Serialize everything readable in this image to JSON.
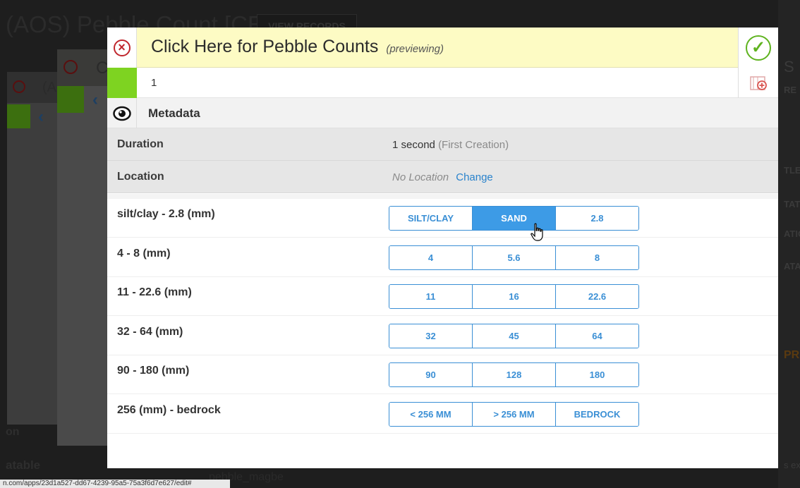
{
  "background": {
    "app_title": "(AOS) Pebble Count [CERT]",
    "view_records_label": "VIEW RECORDS",
    "stack1_title": "(AC",
    "stack2_title": "C",
    "right_col": [
      "S",
      "RE",
      "TLE (S",
      "TATU",
      "ATION",
      "ATA F",
      "PR",
      "s ex"
    ],
    "bottom_left_1": "on",
    "bottom_left_2": "atable",
    "file_name": "pebble_magbe",
    "url": "n.com/apps/23d1a527-dd67-4239-95a5-75a3f6d7e627/edit#"
  },
  "modal": {
    "title": "Click Here for Pebble Counts",
    "title_sub": "(previewing)",
    "row1_value": "1",
    "metadata_label": "Metadata",
    "duration": {
      "label": "Duration",
      "value": "1 second",
      "note": "(First Creation)"
    },
    "location": {
      "label": "Location",
      "value": "No Location",
      "action": "Change"
    }
  },
  "questions": [
    {
      "label": "silt/clay - 2.8 (mm)",
      "options": [
        "SILT/CLAY",
        "SAND",
        "2.8"
      ],
      "selected": 1
    },
    {
      "label": "4 - 8 (mm)",
      "options": [
        "4",
        "5.6",
        "8"
      ],
      "selected": -1
    },
    {
      "label": "11 - 22.6 (mm)",
      "options": [
        "11",
        "16",
        "22.6"
      ],
      "selected": -1
    },
    {
      "label": "32 - 64 (mm)",
      "options": [
        "32",
        "45",
        "64"
      ],
      "selected": -1
    },
    {
      "label": "90 - 180 (mm)",
      "options": [
        "90",
        "128",
        "180"
      ],
      "selected": -1
    },
    {
      "label": "256 (mm) - bedrock",
      "options": [
        "< 256 MM",
        "> 256 MM",
        "BEDROCK"
      ],
      "selected": -1
    }
  ],
  "colors": {
    "accent": "#3d9be6",
    "header_bg": "#fdfbc4",
    "green": "#7ed321",
    "close_red": "#c0262d",
    "confirm_green": "#5fb31f",
    "link": "#2a83cc"
  }
}
